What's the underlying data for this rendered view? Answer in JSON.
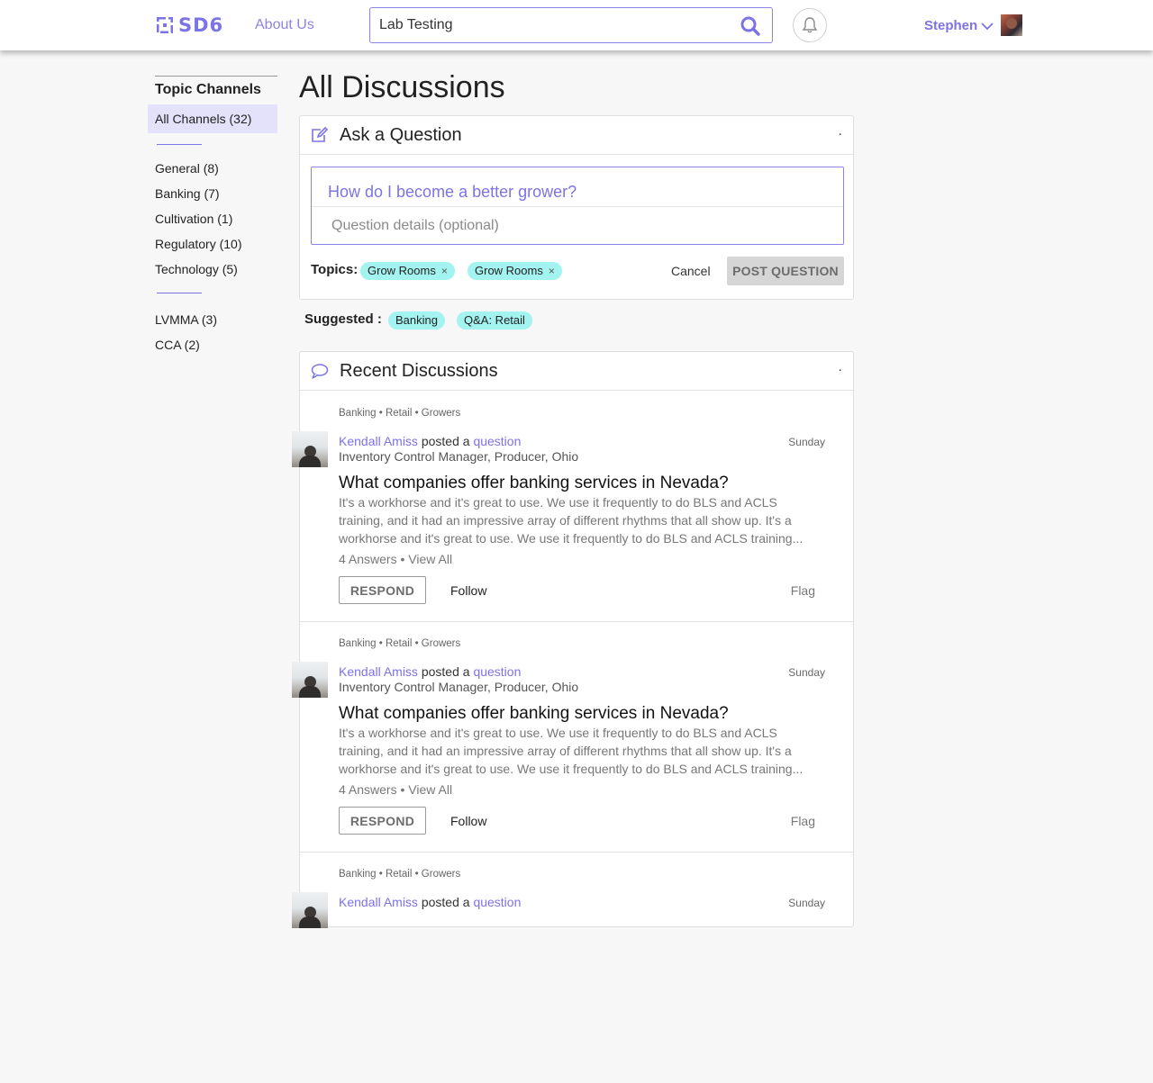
{
  "header": {
    "logo_text": "SD6",
    "about_label": "About Us",
    "search_value": "Lab Testing",
    "search_icon": "search-icon",
    "bell_icon": "bell-icon",
    "user_name": "Stephen",
    "accent_color": "#7b73e6"
  },
  "sidebar": {
    "title": "Topic Channels",
    "items": [
      {
        "label": "All Channels (32)",
        "active": true
      },
      {
        "label": "General (8)"
      },
      {
        "label": "Banking (7)"
      },
      {
        "label": "Cultivation (1)"
      },
      {
        "label": "Regulatory (10)"
      },
      {
        "label": "Technology (5)"
      },
      {
        "label": "LVMMA (3)"
      },
      {
        "label": "CCA (2)"
      }
    ]
  },
  "main": {
    "title": "All Discussions"
  },
  "ask": {
    "title": "Ask a Question",
    "menu": ".",
    "question_placeholder": "How do I become a better grower?",
    "details_placeholder": "Question details (optional)",
    "topics_label": "Topics:",
    "topics": [
      "Grow Rooms",
      "Grow Rooms"
    ],
    "cancel_label": "Cancel",
    "post_label": "POST QUESTION",
    "suggested_label": "Suggested :",
    "suggested": [
      "Banking",
      "Q&A: Retail"
    ],
    "chip_color": "#a3f4f1"
  },
  "recent": {
    "title": "Recent Discussions",
    "menu": ".",
    "posts": [
      {
        "crumbs": "Banking • Retail • Growers",
        "author": "Kendall Amiss",
        "posted_text": "posted a",
        "type_link": "question",
        "date": "Sunday",
        "role": "Inventory Control Manager, Producer, Ohio",
        "title": "What companies offer banking services in Nevada?",
        "excerpt": "It's a workhorse and it's great to use. We use it frequently to do BLS and ACLS training, and it had an impressive array of different rhythms that all show up. It's a workhorse and it's great to use. We use it frequently to do BLS and ACLS training...",
        "answers": "4 Answers",
        "view_all": "View All",
        "respond_label": "RESPOND",
        "follow_label": "Follow",
        "flag_label": "Flag"
      },
      {
        "crumbs": "Banking • Retail • Growers",
        "author": "Kendall Amiss",
        "posted_text": "posted a",
        "type_link": "question",
        "date": "Sunday",
        "role": "Inventory Control Manager, Producer, Ohio",
        "title": "What companies offer banking services in Nevada?",
        "excerpt": "It's a workhorse and it's great to use. We use it frequently to do BLS and ACLS training, and it had an impressive array of different rhythms that all show up. It's a workhorse and it's great to use. We use it frequently to do BLS and ACLS training...",
        "answers": "4 Answers",
        "view_all": "View All",
        "respond_label": "RESPOND",
        "follow_label": "Follow",
        "flag_label": "Flag"
      },
      {
        "crumbs": "Banking • Retail • Growers",
        "author": "Kendall Amiss",
        "posted_text": "posted a",
        "type_link": "question",
        "date": "Sunday"
      }
    ]
  }
}
